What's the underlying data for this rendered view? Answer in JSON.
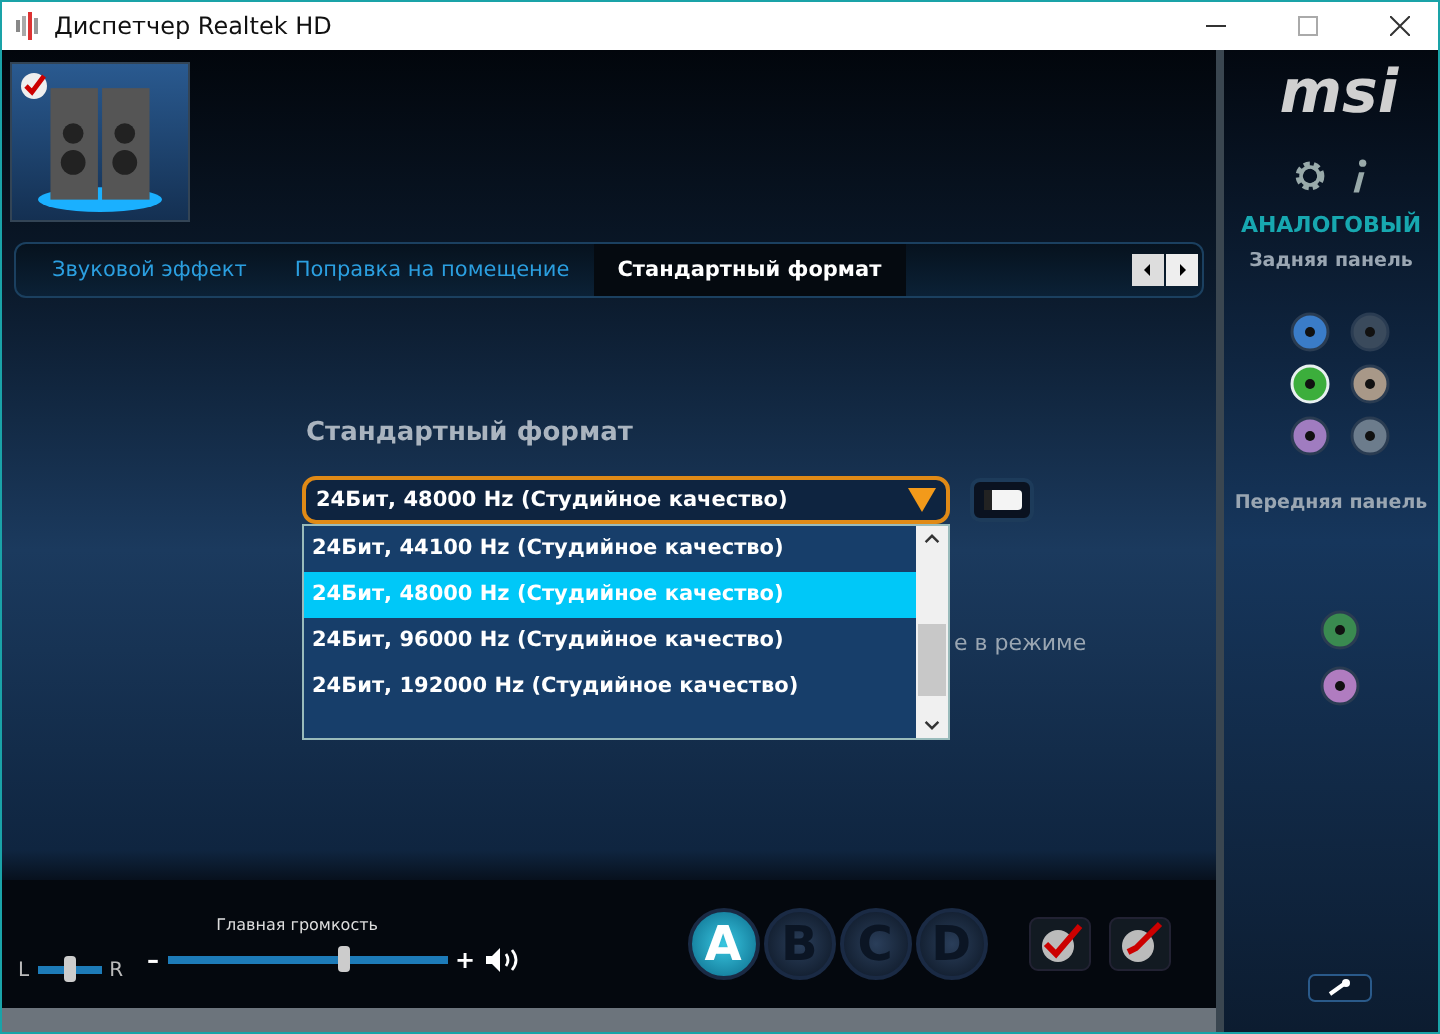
{
  "window": {
    "title": "Диспетчер Realtek HD"
  },
  "device": {
    "checked": true
  },
  "tabs": [
    {
      "label": "Звуковой эффект",
      "selected": false
    },
    {
      "label": "Поправка на помещение",
      "selected": false
    },
    {
      "label": "Стандартный формат",
      "selected": true
    }
  ],
  "section_title": "Стандартный формат",
  "format_select": {
    "value": "24Бит, 48000 Hz (Студийное качество)",
    "expanded": true,
    "options": [
      {
        "label": "24Бит, 44100 Hz (Студийное качество)",
        "selected": false
      },
      {
        "label": "24Бит, 48000 Hz (Студийное качество)",
        "selected": true
      },
      {
        "label": "24Бит, 96000 Hz (Студийное качество)",
        "selected": false
      },
      {
        "label": "24Бит, 192000 Hz (Студийное качество)",
        "selected": false
      }
    ]
  },
  "partial_text": "е в режиме",
  "balance": {
    "left_label": "L",
    "right_label": "R",
    "level": 0.5
  },
  "master_volume": {
    "label": "Главная громкость",
    "minus": "–",
    "plus": "+",
    "level": 0.63
  },
  "profiles": [
    {
      "label": "A",
      "selected": true
    },
    {
      "label": "B",
      "selected": false
    },
    {
      "label": "C",
      "selected": false
    },
    {
      "label": "D",
      "selected": false
    }
  ],
  "side_panel": {
    "logo": "msi",
    "connector_type": "АНАЛОГОВЫЙ",
    "rear_label": "Задняя панель",
    "rear_jacks": [
      {
        "color": "#3a7cc8",
        "active": false
      },
      {
        "color": "#3a4a5c",
        "active": false
      },
      {
        "color": "#3cae3c",
        "active": true
      },
      {
        "color": "#a89888",
        "active": false
      },
      {
        "color": "#a07cc0",
        "active": false
      },
      {
        "color": "#6c7c8c",
        "active": false
      }
    ],
    "front_label": "Передняя панель",
    "front_jacks": [
      {
        "color": "#3a8a50",
        "active": false
      },
      {
        "color": "#b07cc0",
        "active": false
      }
    ]
  }
}
